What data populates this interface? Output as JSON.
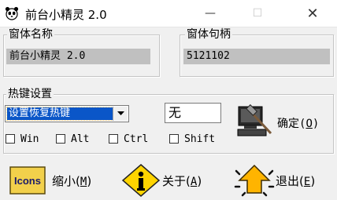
{
  "window": {
    "title": "前台小精灵 2.0",
    "icon": "panda-icon",
    "controls": {
      "minimize": "—",
      "maximize": "☐",
      "close": "✕"
    }
  },
  "window_name_group": {
    "legend": "窗体名称",
    "value": "前台小精灵 2.0"
  },
  "window_handle_group": {
    "legend": "窗体句柄",
    "value": "5121102"
  },
  "hotkey_group": {
    "legend": "热键设置",
    "action_select": {
      "selected": "设置恢复热键"
    },
    "key_value": "无",
    "modifiers": [
      {
        "label": "Win",
        "checked": false
      },
      {
        "label": "Alt",
        "checked": false
      },
      {
        "label": "Ctrl",
        "checked": false
      },
      {
        "label": "Shift",
        "checked": false
      }
    ],
    "confirm": {
      "label": "确定",
      "shortcut": "O",
      "icon": "computer-hammer-icon"
    }
  },
  "actions": {
    "minimize": {
      "label": "缩小",
      "shortcut": "M",
      "icon": "icons-badge-icon",
      "icon_text": "Icons"
    },
    "about": {
      "label": "关于",
      "shortcut": "A",
      "icon": "info-icon"
    },
    "exit": {
      "label": "退出",
      "shortcut": "E",
      "icon": "exit-arrow-icon"
    }
  },
  "colors": {
    "window_bg": "#f0f0f0",
    "field_bg": "#c0c0c0",
    "selection": "#0a56c8"
  }
}
